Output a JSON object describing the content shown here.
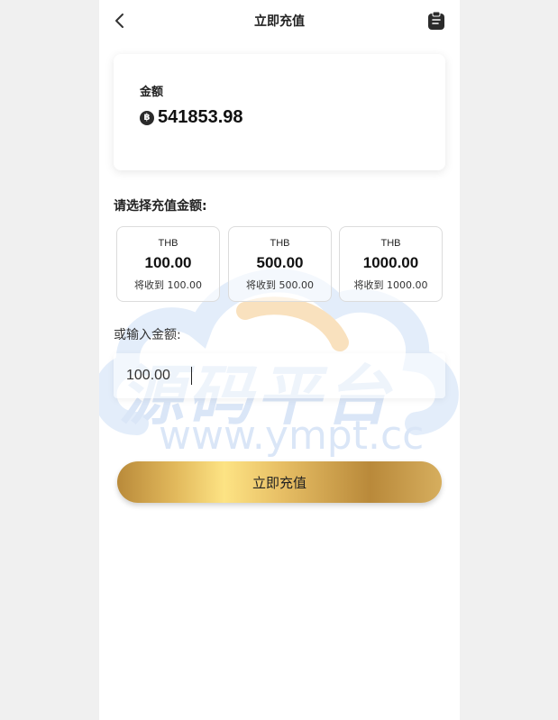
{
  "header": {
    "title": "立即充值",
    "back_icon": "chevron-left-icon",
    "record_icon": "clipboard-icon"
  },
  "balance": {
    "label": "金额",
    "currency_icon": "฿",
    "value": "541853.98"
  },
  "options_section": {
    "title": "请选择充值金额:",
    "options": [
      {
        "currency": "THB",
        "amount": "100.00",
        "receive": "将收到 100.00"
      },
      {
        "currency": "THB",
        "amount": "500.00",
        "receive": "将收到 500.00"
      },
      {
        "currency": "THB",
        "amount": "1000.00",
        "receive": "将收到 1000.00"
      }
    ]
  },
  "custom_input": {
    "label": "或输入金额:",
    "value": "100.00"
  },
  "submit": {
    "label": "立即充值"
  },
  "watermark": {
    "main_text": "源码平台",
    "url_text": "www.ympt.cc"
  },
  "colors": {
    "page_background": "#f0f0f0",
    "card_background": "#ffffff",
    "gold_accent": "#e2b95c",
    "watermark_blue": "#bcd2f2",
    "watermark_orange": "#f5c98a"
  }
}
